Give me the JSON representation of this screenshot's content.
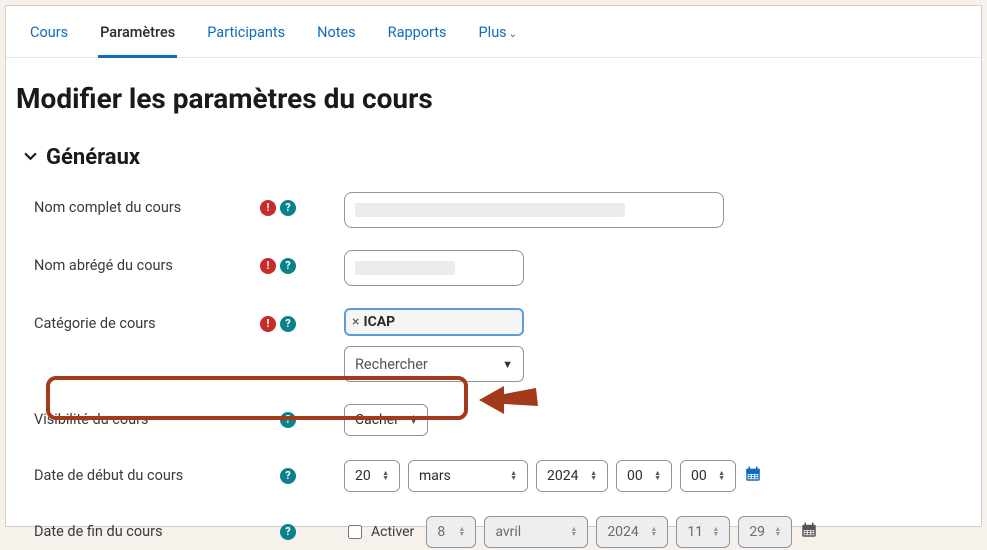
{
  "tabs": {
    "course": "Cours",
    "settings": "Paramètres",
    "participants": "Participants",
    "grades": "Notes",
    "reports": "Rapports",
    "more": "Plus"
  },
  "page_title": "Modifier les paramètres du cours",
  "section_general": "Généraux",
  "labels": {
    "fullname": "Nom complet du cours",
    "shortname": "Nom abrégé du cours",
    "category": "Catégorie de cours",
    "visibility": "Visibilité du cours",
    "startdate": "Date de début du cours",
    "enddate": "Date de fin du cours"
  },
  "category_tag": "ICAP",
  "search_placeholder": "Rechercher",
  "visibility_value": "Cacher",
  "activer_label": "Activer",
  "start": {
    "day": "20",
    "month": "mars",
    "year": "2024",
    "hour": "00",
    "min": "00"
  },
  "end": {
    "day": "8",
    "month": "avril",
    "year": "2024",
    "hour": "11",
    "min": "29"
  },
  "icons": {
    "required": "!",
    "help": "?"
  }
}
